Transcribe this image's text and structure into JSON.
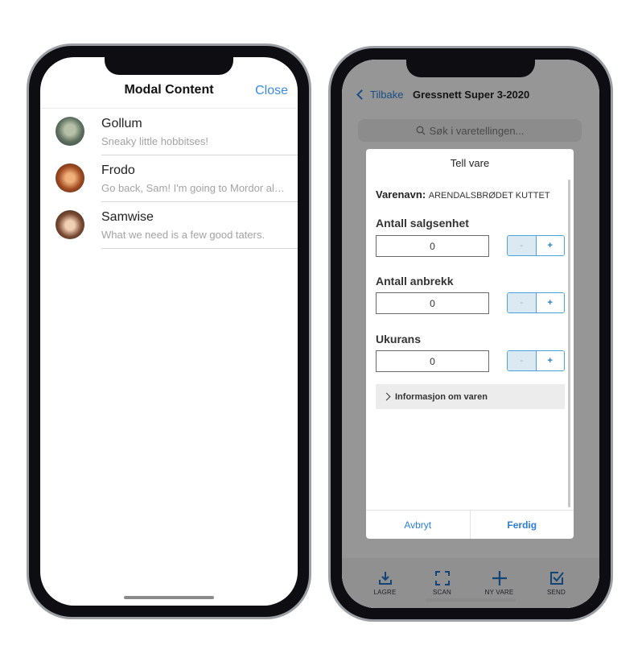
{
  "left_phone": {
    "header": {
      "title": "Modal Content",
      "close_label": "Close"
    },
    "contacts": [
      {
        "name": "Gollum",
        "message": "Sneaky little hobbitses!"
      },
      {
        "name": "Frodo",
        "message": "Go back, Sam! I'm going to Mordor alone!"
      },
      {
        "name": "Samwise",
        "message": "What we need is a few good taters."
      }
    ]
  },
  "right_phone": {
    "nav": {
      "back_label": "Tilbake",
      "title": "Gressnett Super 3-2020"
    },
    "search": {
      "placeholder": "Søk i varetellingen..."
    },
    "dialog": {
      "title": "Tell vare",
      "varenavn_label": "Varenavn:",
      "varenavn_value": "ARENDALSBRØDET KUTTET",
      "fields": [
        {
          "label": "Antall salgsenhet",
          "value": "0"
        },
        {
          "label": "Antall anbrekk",
          "value": "0"
        },
        {
          "label": "Ukurans",
          "value": "0"
        }
      ],
      "stepper": {
        "minus": "-",
        "plus": "+"
      },
      "info_label": "Informasjon om varen",
      "cancel_label": "Avbryt",
      "done_label": "Ferdig"
    },
    "toolbar": [
      {
        "label": "LAGRE",
        "icon": "download-icon"
      },
      {
        "label": "SCAN",
        "icon": "scan-icon"
      },
      {
        "label": "NY VARE",
        "icon": "plus-icon"
      },
      {
        "label": "SEND",
        "icon": "send-check-icon"
      }
    ],
    "colors": {
      "accent": "#2a7ed6",
      "stepper_border": "#4aa3d8"
    }
  }
}
